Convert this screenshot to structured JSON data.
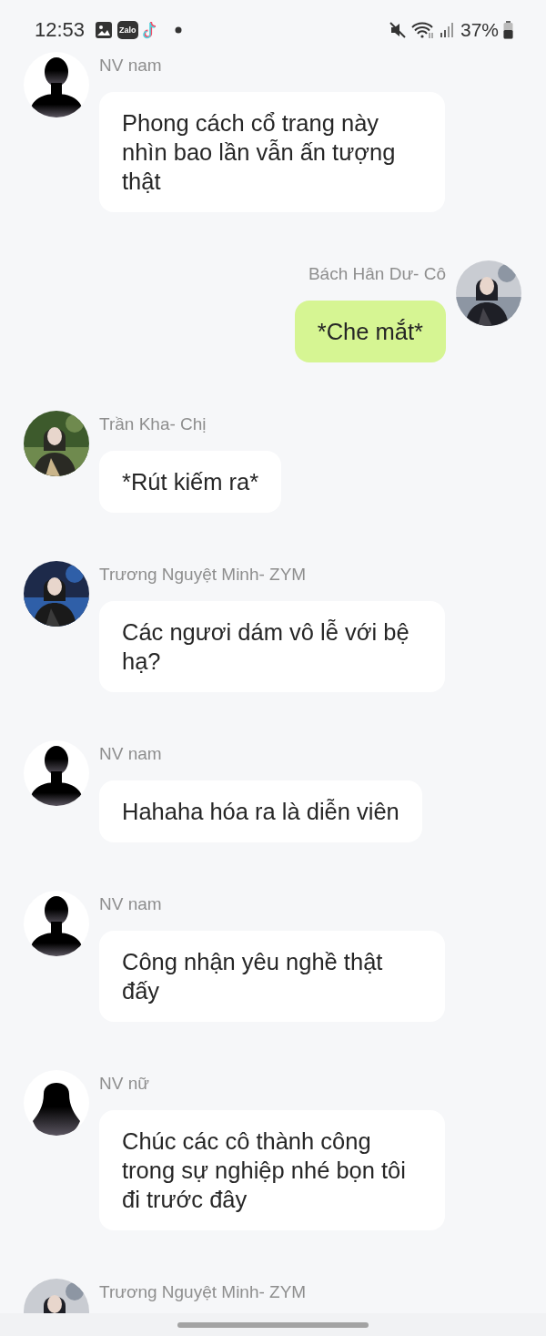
{
  "status_bar": {
    "time": "12:53",
    "notification_icons": [
      {
        "kind": "gallery"
      },
      {
        "kind": "zalo",
        "label": "Zalo"
      },
      {
        "kind": "tiktok"
      },
      {
        "kind": "dot"
      }
    ],
    "system_icons": [
      {
        "kind": "mute"
      },
      {
        "kind": "wifi"
      },
      {
        "kind": "signal"
      }
    ],
    "battery": "37%"
  },
  "messages": [
    {
      "sender": "NV nam",
      "avatar": {
        "kind": "male"
      },
      "outgoing": false,
      "text": "Phong cách cổ trang này nhìn bao lần vẫn ấn tượng thật"
    },
    {
      "sender": "Bách Hân Dư- Cô",
      "outgoing": true,
      "text": "*Che mắt*"
    },
    {
      "sender": "Trần Kha- Chị",
      "outgoing": false,
      "text": "*Rút kiếm ra*"
    },
    {
      "sender": "Trương Nguyệt Minh- ZYM",
      "outgoing": false,
      "text": "Các ngươi dám vô lễ với bệ hạ?"
    },
    {
      "sender": "NV nam",
      "avatar": {
        "kind": "male"
      },
      "outgoing": false,
      "text": "Hahaha hóa ra là diễn viên"
    },
    {
      "sender": "NV nam",
      "avatar": {
        "kind": "male"
      },
      "outgoing": false,
      "text": "Công nhận yêu nghề thật đấy"
    },
    {
      "sender": "NV nữ",
      "avatar": {
        "kind": "female"
      },
      "outgoing": false,
      "text": "Chúc các cô thành công trong sự nghiệp nhé bọn tôi đi trước đây"
    },
    {
      "sender": "Trương Nguyệt Minh- ZYM",
      "outgoing": false
    }
  ]
}
